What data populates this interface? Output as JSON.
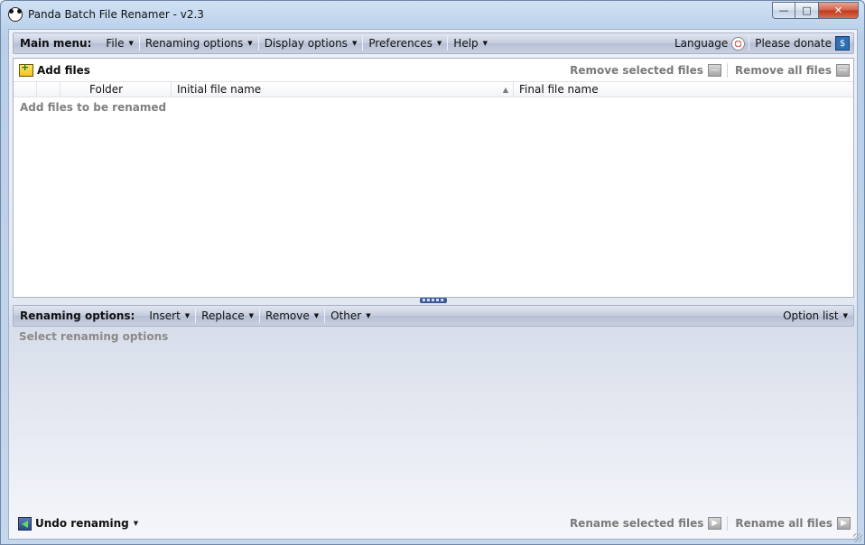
{
  "window": {
    "title": "Panda Batch File Renamer - v2.3",
    "controls": {
      "minimize": "—",
      "maximize": "□",
      "close": "✕"
    }
  },
  "main_menu": {
    "label": "Main menu:",
    "items": [
      {
        "label": "File"
      },
      {
        "label": "Renaming options"
      },
      {
        "label": "Display options"
      },
      {
        "label": "Preferences"
      },
      {
        "label": "Help"
      }
    ],
    "language_label": "Language",
    "donate_label": "Please donate"
  },
  "files_panel": {
    "add_files_label": "Add files",
    "remove_selected_label": "Remove selected files",
    "remove_all_label": "Remove all files",
    "columns": [
      "",
      "",
      "Folder",
      "Initial file name",
      "Final file name"
    ],
    "empty_message": "Add files to be renamed"
  },
  "renaming_options": {
    "label": "Renaming options:",
    "items": [
      {
        "label": "Insert"
      },
      {
        "label": "Replace"
      },
      {
        "label": "Remove"
      },
      {
        "label": "Other"
      }
    ],
    "option_list_label": "Option list",
    "empty_message": "Select renaming options"
  },
  "bottom": {
    "undo_label": "Undo renaming",
    "rename_selected_label": "Rename selected files",
    "rename_all_label": "Rename all files"
  }
}
